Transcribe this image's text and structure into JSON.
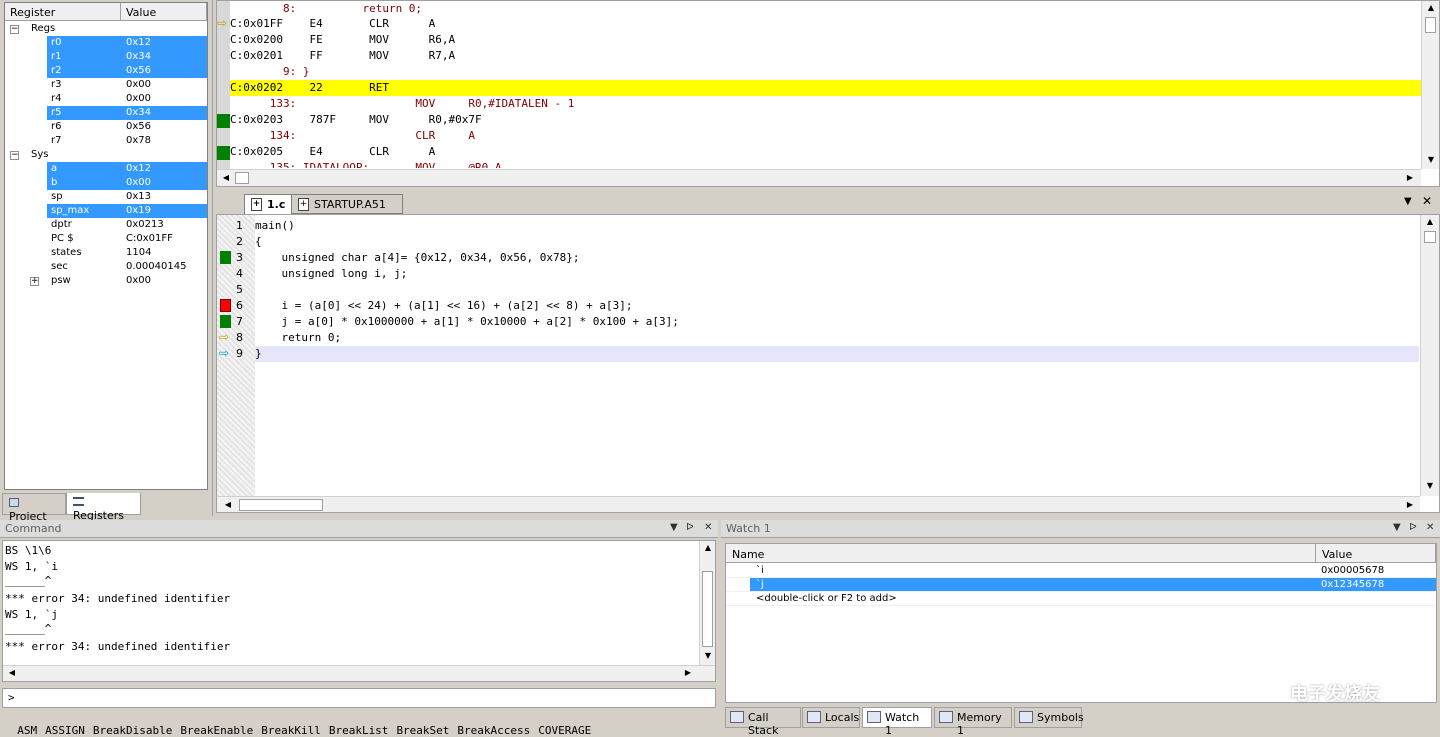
{
  "registers": {
    "header": {
      "register": "Register",
      "value": "Value"
    },
    "groups": [
      {
        "name": "Regs"
      },
      {
        "name": "Sys"
      }
    ],
    "regs": [
      {
        "name": "r0",
        "value": "0x12"
      },
      {
        "name": "r1",
        "value": "0x34"
      },
      {
        "name": "r2",
        "value": "0x56"
      },
      {
        "name": "r3",
        "value": "0x00"
      },
      {
        "name": "r4",
        "value": "0x00"
      },
      {
        "name": "r5",
        "value": "0x34"
      },
      {
        "name": "r6",
        "value": "0x56"
      },
      {
        "name": "r7",
        "value": "0x78"
      }
    ],
    "sys": [
      {
        "name": "a",
        "value": "0x12"
      },
      {
        "name": "b",
        "value": "0x00"
      },
      {
        "name": "sp",
        "value": "0x13"
      },
      {
        "name": "sp_max",
        "value": "0x19"
      },
      {
        "name": "dptr",
        "value": "0x0213"
      },
      {
        "name": "PC  $",
        "value": "C:0x01FF"
      },
      {
        "name": "states",
        "value": "1104"
      },
      {
        "name": "sec",
        "value": "0.00040145"
      },
      {
        "name": "psw",
        "value": "0x00"
      }
    ],
    "tabs": {
      "project": "Project",
      "registers": "Registers"
    }
  },
  "disassembly": {
    "lines": [
      {
        "text": "        8:          return 0;",
        "kind": "src"
      },
      {
        "text": "C:0x01FF    E4       CLR      A",
        "kind": "asm"
      },
      {
        "text": "C:0x0200    FE       MOV      R6,A",
        "kind": "asm"
      },
      {
        "text": "C:0x0201    FF       MOV      R7,A",
        "kind": "asm"
      },
      {
        "text": "        9: }",
        "kind": "src"
      },
      {
        "text": "C:0x0202    22       RET",
        "kind": "cur"
      },
      {
        "text": "      133:                  MOV     R0,#IDATALEN - 1",
        "kind": "src"
      },
      {
        "text": "C:0x0203    787F     MOV      R0,#0x7F",
        "kind": "asm"
      },
      {
        "text": "      134:                  CLR     A",
        "kind": "src"
      },
      {
        "text": "C:0x0205    E4       CLR      A",
        "kind": "asm"
      },
      {
        "text": "      135: IDATALOOP:       MOV     @R0,A",
        "kind": "src"
      }
    ]
  },
  "editor": {
    "tabs": [
      {
        "label": "1.c"
      },
      {
        "label": "STARTUP.A51"
      }
    ],
    "lines": [
      {
        "n": "1",
        "code": "main()"
      },
      {
        "n": "2",
        "code": "{"
      },
      {
        "n": "3",
        "code": "    unsigned char a[4]= {0x12, 0x34, 0x56, 0x78};"
      },
      {
        "n": "4",
        "code": "    unsigned long i, j;"
      },
      {
        "n": "5",
        "code": ""
      },
      {
        "n": "6",
        "code": "    i = (a[0] << 24) + (a[1] << 16) + (a[2] << 8) + a[3];"
      },
      {
        "n": "7",
        "code": "    j = a[0] * 0x1000000 + a[1] * 0x10000 + a[2] * 0x100 + a[3];"
      },
      {
        "n": "8",
        "code": "    return 0;"
      },
      {
        "n": "9",
        "code": "}"
      }
    ]
  },
  "command": {
    "title": "Command",
    "output": [
      "BS \\1\\6",
      "WS 1, `i",
      "______^",
      "*** error 34: undefined identifier",
      "WS 1, `j",
      "______^",
      "*** error 34: undefined identifier"
    ],
    "prompt": ">",
    "keywords": [
      "ASM",
      "ASSIGN",
      "BreakDisable",
      "BreakEnable",
      "BreakKill",
      "BreakList",
      "BreakSet",
      "BreakAccess",
      "COVERAGE"
    ]
  },
  "watch": {
    "title": "Watch 1",
    "columns": {
      "name": "Name",
      "value": "Value"
    },
    "rows": [
      {
        "name": "`i",
        "value": "0x00005678"
      },
      {
        "name": "`j",
        "value": "0x12345678"
      },
      {
        "name": "<double-click or F2 to add>",
        "value": ""
      }
    ],
    "tabs": [
      "Call Stack",
      "Locals",
      "Watch 1",
      "Memory 1",
      "Symbols"
    ]
  },
  "watermark": "电子发烧友",
  "colors": {
    "selection": "#3399ff",
    "current_line": "#ffff00",
    "breakpoint": "#ff0000",
    "executed": "#008000"
  }
}
